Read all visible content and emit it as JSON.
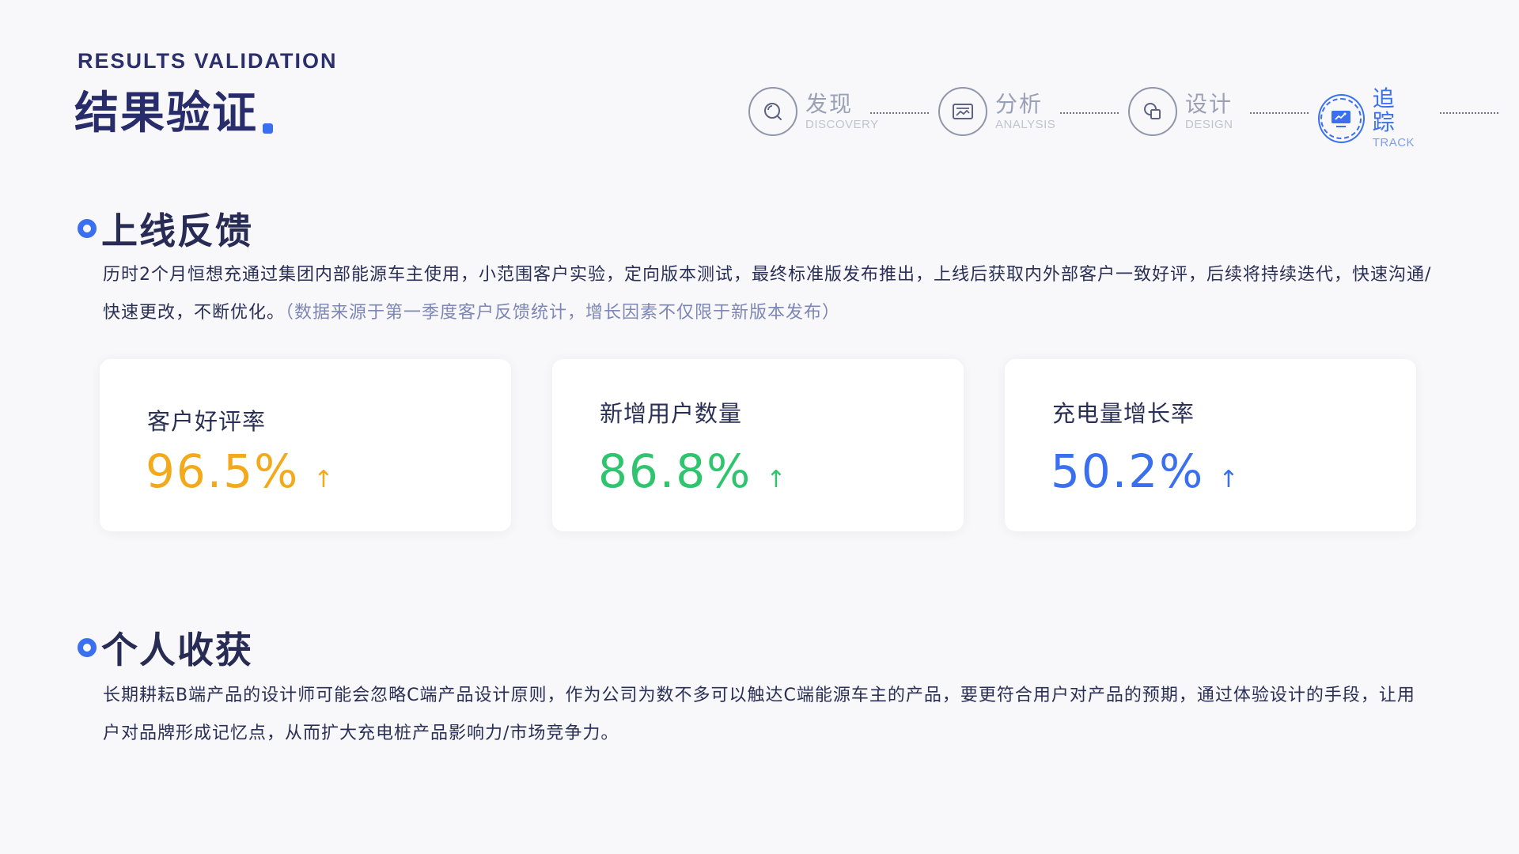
{
  "header": {
    "eyebrow": "RESULTS VALIDATION",
    "title": "结果验证"
  },
  "steps": [
    {
      "cn": "发现",
      "en": "DISCOVERY",
      "icon": "search-icon",
      "active": false
    },
    {
      "cn": "分析",
      "en": "ANALYSIS",
      "icon": "image-icon",
      "active": false
    },
    {
      "cn": "设计",
      "en": "DESIGN",
      "icon": "shapes-icon",
      "active": false
    },
    {
      "cn": "追踪",
      "en": "TRACK",
      "icon": "monitor-chart-icon",
      "active": true
    }
  ],
  "feedback": {
    "title": "上线反馈",
    "body": "历时2个月恒想充通过集团内部能源车主使用，小范围客户实验，定向版本测试，最终标准版发布推出，上线后获取内外部客户一致好评，后续将持续迭代，快速沟通/快速更改，不断优化。",
    "note": "（数据来源于第一季度客户反馈统计，增长因素不仅限于新版本发布）"
  },
  "metrics": [
    {
      "label": "客户好评率",
      "value": "96.5%",
      "arrow": "↑",
      "color": "#f2aa1c"
    },
    {
      "label": "新增用户数量",
      "value": "86.8%",
      "arrow": "↑",
      "color": "#2fc46e"
    },
    {
      "label": "充电量增长率",
      "value": "50.2%",
      "arrow": "↑",
      "color": "#3a6ff0"
    }
  ],
  "gains": {
    "title": "个人收获",
    "body": "长期耕耘B端产品的设计师可能会忽略C端产品设计原则，作为公司为数不多可以触达C端能源车主的产品，要更符合用户对产品的预期，通过体验设计的手段，让用户对品牌形成记忆点，从而扩大充电桩产品影响力/市场竞争力。"
  },
  "colors": {
    "accent": "#3a6ff0",
    "title": "#282c6a",
    "note": "#7d86b5"
  }
}
